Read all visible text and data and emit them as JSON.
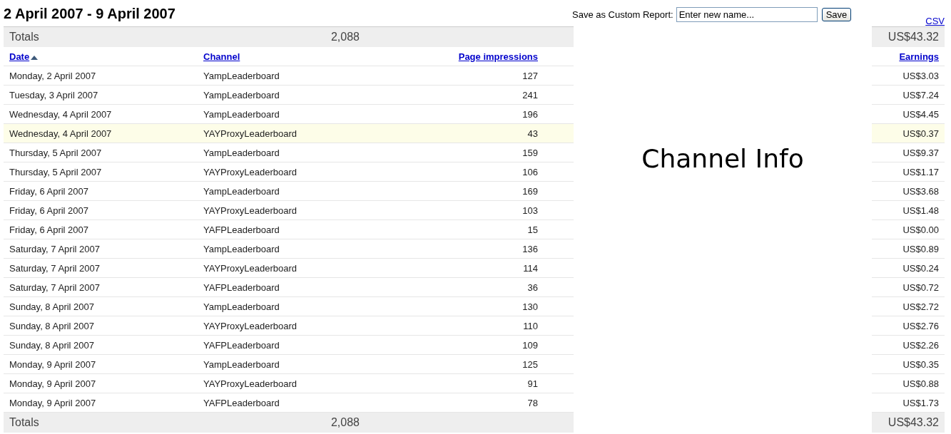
{
  "title": "2 April 2007 - 9 April 2007",
  "save_report": {
    "label": "Save as Custom Report:",
    "placeholder": "Enter new name...",
    "button": "Save"
  },
  "csv_link": "CSV",
  "totals_top": {
    "label": "Totals",
    "impressions": "2,088",
    "earnings": "US$43.32"
  },
  "columns": {
    "date": "Date",
    "channel": "Channel",
    "impressions": "Page impressions",
    "earnings": "Earnings",
    "date_sorted": true
  },
  "rows": [
    {
      "date": "Monday, 2 April 2007",
      "channel": "YampLeaderboard",
      "impressions": "127",
      "earnings": "US$3.03",
      "highlighted": false
    },
    {
      "date": "Tuesday, 3 April 2007",
      "channel": "YampLeaderboard",
      "impressions": "241",
      "earnings": "US$7.24",
      "highlighted": false
    },
    {
      "date": "Wednesday, 4 April 2007",
      "channel": "YampLeaderboard",
      "impressions": "196",
      "earnings": "US$4.45",
      "highlighted": false
    },
    {
      "date": "Wednesday, 4 April 2007",
      "channel": "YAYProxyLeaderboard",
      "impressions": "43",
      "earnings": "US$0.37",
      "highlighted": true
    },
    {
      "date": "Thursday, 5 April 2007",
      "channel": "YampLeaderboard",
      "impressions": "159",
      "earnings": "US$9.37",
      "highlighted": false
    },
    {
      "date": "Thursday, 5 April 2007",
      "channel": "YAYProxyLeaderboard",
      "impressions": "106",
      "earnings": "US$1.17",
      "highlighted": false
    },
    {
      "date": "Friday, 6 April 2007",
      "channel": "YampLeaderboard",
      "impressions": "169",
      "earnings": "US$3.68",
      "highlighted": false
    },
    {
      "date": "Friday, 6 April 2007",
      "channel": "YAYProxyLeaderboard",
      "impressions": "103",
      "earnings": "US$1.48",
      "highlighted": false
    },
    {
      "date": "Friday, 6 April 2007",
      "channel": "YAFPLeaderboard",
      "impressions": "15",
      "earnings": "US$0.00",
      "highlighted": false
    },
    {
      "date": "Saturday, 7 April 2007",
      "channel": "YampLeaderboard",
      "impressions": "136",
      "earnings": "US$0.89",
      "highlighted": false
    },
    {
      "date": "Saturday, 7 April 2007",
      "channel": "YAYProxyLeaderboard",
      "impressions": "114",
      "earnings": "US$0.24",
      "highlighted": false
    },
    {
      "date": "Saturday, 7 April 2007",
      "channel": "YAFPLeaderboard",
      "impressions": "36",
      "earnings": "US$0.72",
      "highlighted": false
    },
    {
      "date": "Sunday, 8 April 2007",
      "channel": "YampLeaderboard",
      "impressions": "130",
      "earnings": "US$2.72",
      "highlighted": false
    },
    {
      "date": "Sunday, 8 April 2007",
      "channel": "YAYProxyLeaderboard",
      "impressions": "110",
      "earnings": "US$2.76",
      "highlighted": false
    },
    {
      "date": "Sunday, 8 April 2007",
      "channel": "YAFPLeaderboard",
      "impressions": "109",
      "earnings": "US$2.26",
      "highlighted": false
    },
    {
      "date": "Monday, 9 April 2007",
      "channel": "YampLeaderboard",
      "impressions": "125",
      "earnings": "US$0.35",
      "highlighted": false
    },
    {
      "date": "Monday, 9 April 2007",
      "channel": "YAYProxyLeaderboard",
      "impressions": "91",
      "earnings": "US$0.88",
      "highlighted": false
    },
    {
      "date": "Monday, 9 April 2007",
      "channel": "YAFPLeaderboard",
      "impressions": "78",
      "earnings": "US$1.73",
      "highlighted": false
    }
  ],
  "totals_bottom": {
    "label": "Totals",
    "impressions": "2,088",
    "earnings": "US$43.32"
  },
  "channel_info": "Channel Info"
}
